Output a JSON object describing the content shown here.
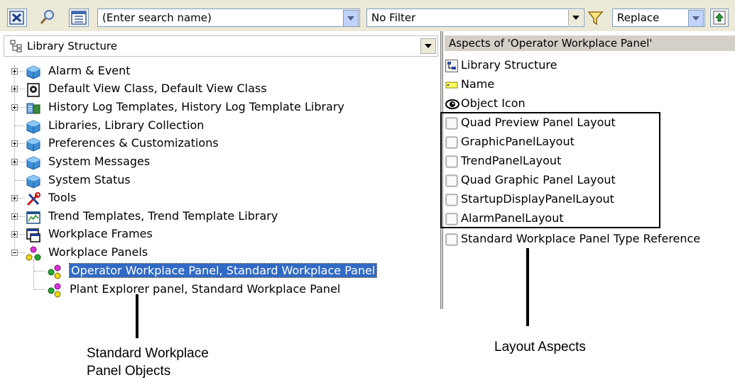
{
  "toolbar": {
    "search_placeholder": "(Enter search name)",
    "filter_value": "No Filter",
    "mode_value": "Replace"
  },
  "left_panel": {
    "structure_label": "Library Structure",
    "tree": [
      {
        "label": "Alarm & Event",
        "icon": "cube-icon",
        "expander": "plus"
      },
      {
        "label": "Default View Class, Default View Class",
        "icon": "view-class-icon",
        "expander": "plus"
      },
      {
        "label": "History Log Templates, History Log Template Library",
        "icon": "history-log-icon",
        "expander": "plus"
      },
      {
        "label": "Libraries, Library Collection",
        "icon": "cube-icon",
        "expander": "none"
      },
      {
        "label": "Preferences & Customizations",
        "icon": "cube-icon",
        "expander": "plus"
      },
      {
        "label": "System Messages",
        "icon": "cube-icon",
        "expander": "plus"
      },
      {
        "label": "System Status",
        "icon": "cube-icon",
        "expander": "none"
      },
      {
        "label": "Tools",
        "icon": "tools-icon",
        "expander": "plus"
      },
      {
        "label": "Trend Templates, Trend Template Library",
        "icon": "trend-icon",
        "expander": "plus"
      },
      {
        "label": "Workplace Frames",
        "icon": "frame-icon",
        "expander": "plus"
      },
      {
        "label": "Workplace Panels",
        "icon": "panels-icon",
        "expander": "minus"
      },
      {
        "label": "Operator Workplace Panel, Standard Workplace Panel",
        "icon": "panel-object-icon",
        "selected": true
      },
      {
        "label": "Plant Explorer panel, Standard Workplace Panel",
        "icon": "panel-object-icon"
      }
    ]
  },
  "right_panel": {
    "header": "Aspects of 'Operator Workplace Panel'",
    "aspects": [
      {
        "label": "Library Structure",
        "icon": "structure-icon"
      },
      {
        "label": "Name",
        "icon": "name-tag-icon"
      },
      {
        "label": "Object Icon",
        "icon": "eye-icon"
      },
      {
        "label": "Quad Preview Panel Layout",
        "icon": "blank-aspect-icon"
      },
      {
        "label": "GraphicPanelLayout",
        "icon": "blank-aspect-icon"
      },
      {
        "label": "TrendPanelLayout",
        "icon": "blank-aspect-icon"
      },
      {
        "label": "Quad Graphic Panel Layout",
        "icon": "blank-aspect-icon"
      },
      {
        "label": "StartupDisplayPanelLayout",
        "icon": "blank-aspect-icon"
      },
      {
        "label": "AlarmPanelLayout",
        "icon": "blank-aspect-icon"
      },
      {
        "label": "Standard Workplace Panel Type Reference",
        "icon": "blank-aspect-icon"
      }
    ]
  },
  "callouts": {
    "left_line1": "Standard Workplace",
    "left_line2": "Panel Objects",
    "right": "Layout Aspects"
  }
}
